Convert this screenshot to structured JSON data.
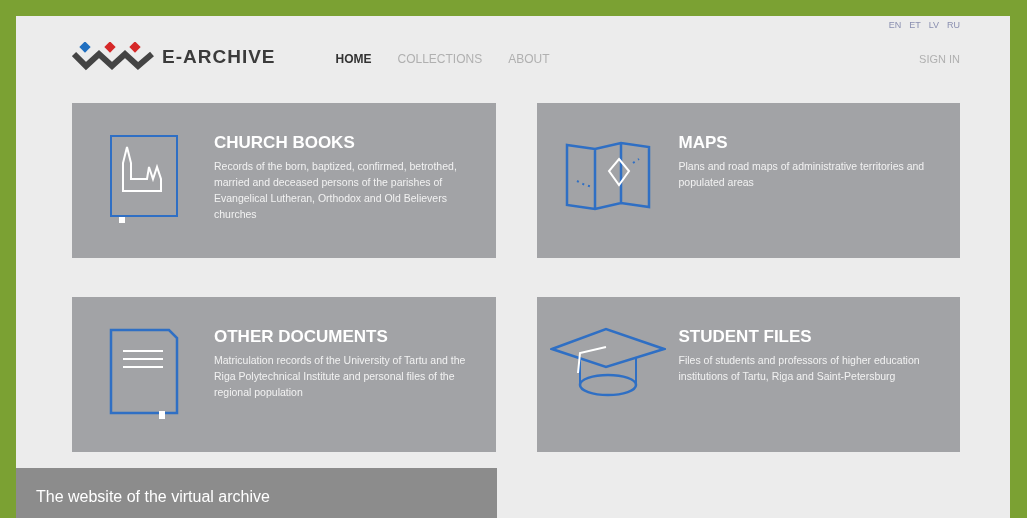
{
  "languages": [
    "EN",
    "ET",
    "LV",
    "RU"
  ],
  "logo": {
    "text": "E-ARCHIVE"
  },
  "nav": [
    {
      "label": "HOME",
      "selected": true
    },
    {
      "label": "COLLECTIONS",
      "selected": false
    },
    {
      "label": "ABOUT",
      "selected": false
    }
  ],
  "sign_in": "SIGN IN",
  "cards": [
    {
      "kind": "church",
      "title": "CHURCH BOOKS",
      "text": "Records of the born, baptized, confirmed, betrothed, married and deceased persons of the parishes of Evangelical Lutheran, Orthodox and Old Believers churches"
    },
    {
      "kind": "map",
      "title": "MAPS",
      "text": "Plans and road maps of administrative territories and populated areas"
    },
    {
      "kind": "document",
      "title": "OTHER DOCUMENTS",
      "text": "Matriculation records of the University of Tartu and the Riga Polytechnical Institute and personal files of the regional population"
    },
    {
      "kind": "cap",
      "title": "STUDENT FILES",
      "text": "Files of students and professors of higher education institutions of Tartu, Riga and Saint-Petersburg"
    }
  ],
  "caption": "The website of the virtual archive"
}
